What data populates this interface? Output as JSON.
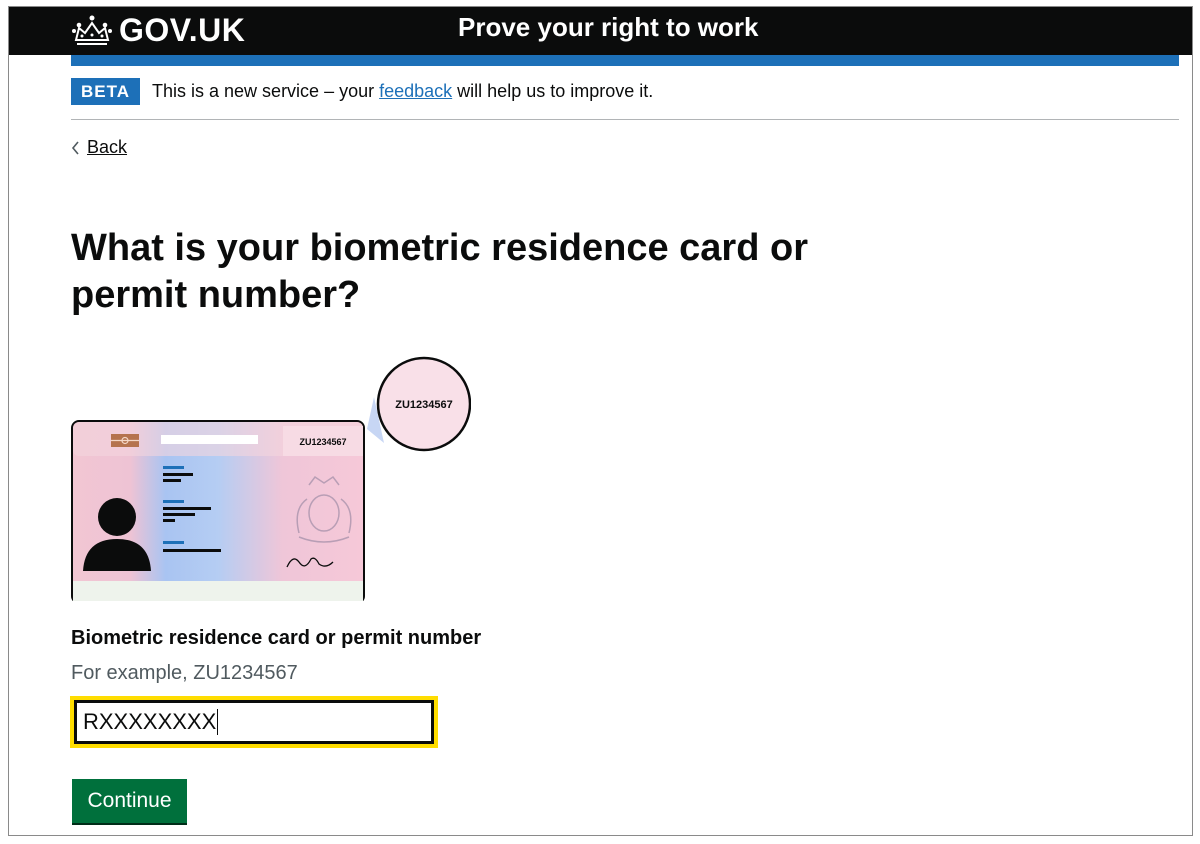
{
  "header": {
    "logo_text": "GOV.UK",
    "service_name": "Prove your right to work"
  },
  "phase_banner": {
    "tag": "BETA",
    "text_before": "This is a new service – your ",
    "link": "feedback",
    "text_after": " will help us to improve it."
  },
  "back_link": {
    "label": "Back"
  },
  "page": {
    "heading": "What is your biometric residence card or permit number?"
  },
  "illustration": {
    "card_number": "ZU1234567",
    "zoom_number": "ZU1234567"
  },
  "form": {
    "label": "Biometric residence card or permit number",
    "hint": "For example, ZU1234567",
    "value": "RXXXXXXXX"
  },
  "actions": {
    "continue_label": "Continue"
  },
  "colors": {
    "header_bg": "#0b0c0c",
    "brand_blue": "#1d70b8",
    "focus_yellow": "#ffdd00",
    "button_green": "#00703c"
  }
}
